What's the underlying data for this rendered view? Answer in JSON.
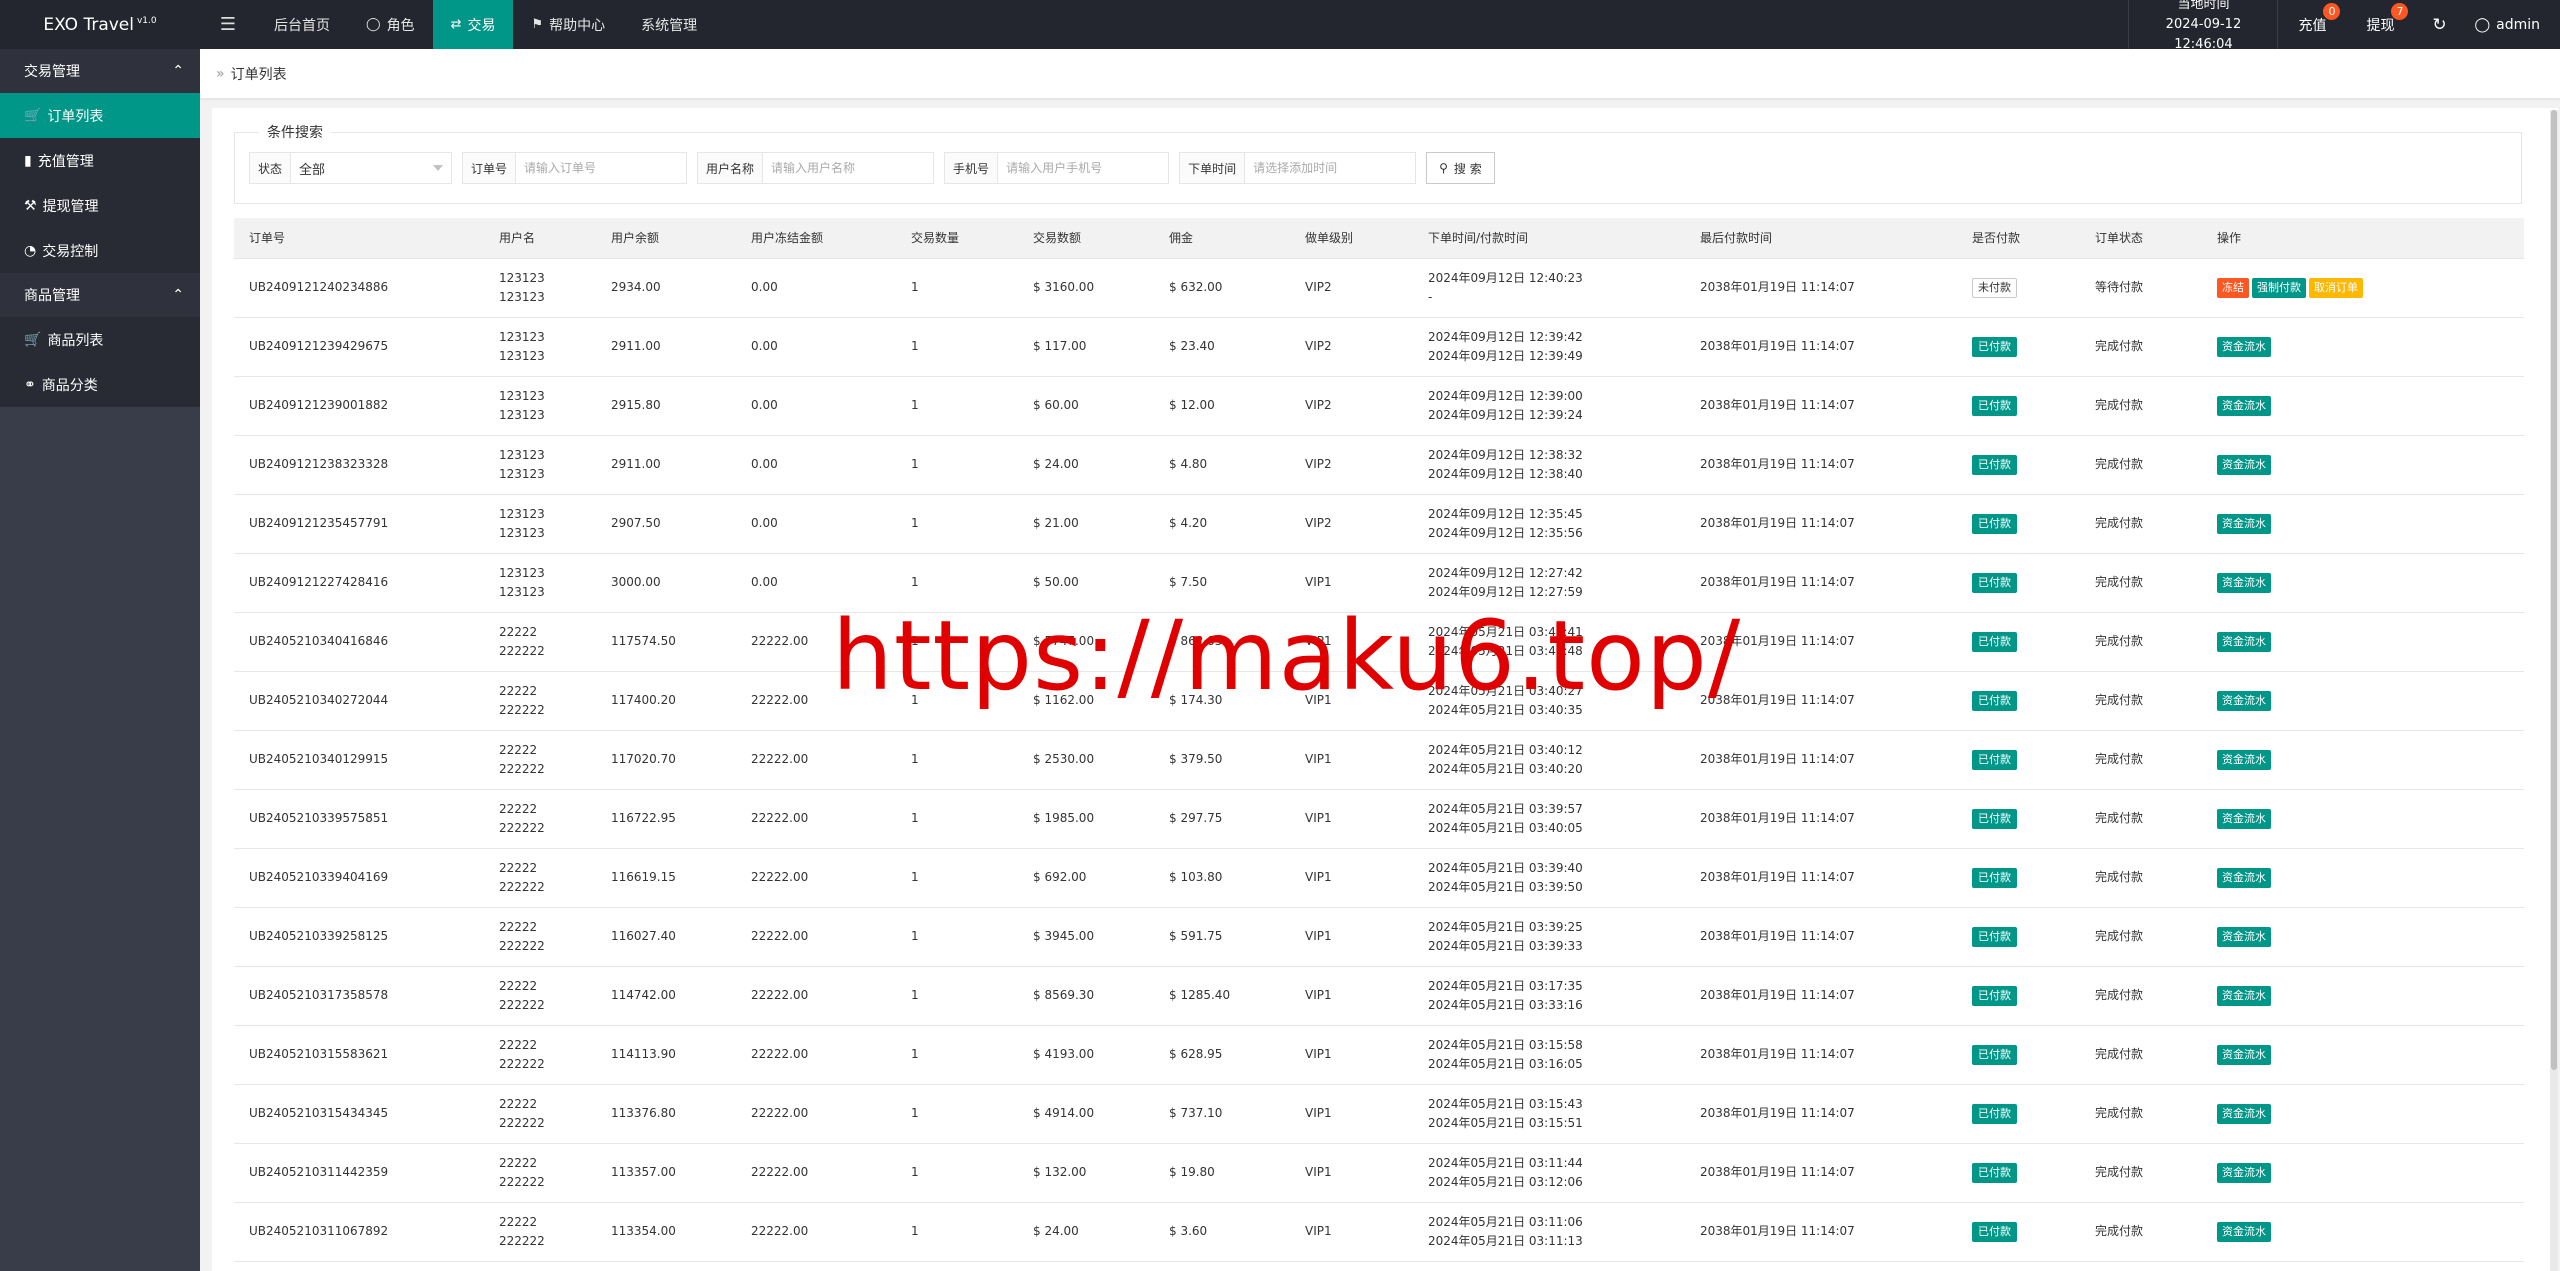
{
  "app": {
    "name": "EXO Travel",
    "version": "v1.0"
  },
  "topnav": [
    {
      "label": "后台首页",
      "icon": "",
      "active": false
    },
    {
      "label": "角色",
      "icon": "user-icon",
      "active": false
    },
    {
      "label": "交易",
      "icon": "exchange-icon",
      "active": true
    },
    {
      "label": "帮助中心",
      "icon": "flag-icon",
      "active": false
    },
    {
      "label": "系统管理",
      "icon": "",
      "active": false
    }
  ],
  "clock": {
    "label": "当地时间",
    "value": "2024-09-12 12:46:04"
  },
  "recharge": {
    "label": "充值",
    "badge": "0"
  },
  "withdraw": {
    "label": "提现",
    "badge": "7"
  },
  "user": {
    "name": "admin"
  },
  "sidebar": {
    "groups": [
      {
        "label": "交易管理",
        "items": [
          {
            "label": "订单列表",
            "icon": "cart-icon",
            "active": true
          },
          {
            "label": "充值管理",
            "icon": "comment-icon",
            "active": false
          },
          {
            "label": "提现管理",
            "icon": "hammer-icon",
            "active": false
          },
          {
            "label": "交易控制",
            "icon": "gauge-icon",
            "active": false
          }
        ]
      },
      {
        "label": "商品管理",
        "items": [
          {
            "label": "商品列表",
            "icon": "cart-icon",
            "active": false
          },
          {
            "label": "商品分类",
            "icon": "link-icon",
            "active": false
          }
        ]
      }
    ]
  },
  "breadcrumb": {
    "label": "订单列表"
  },
  "search": {
    "legend": "条件搜索",
    "status_label": "状态",
    "status_value": "全部",
    "order_label": "订单号",
    "order_placeholder": "请输入订单号",
    "username_label": "用户名称",
    "username_placeholder": "请输入用户名称",
    "phone_label": "手机号",
    "phone_placeholder": "请输入用户手机号",
    "time_label": "下单时间",
    "time_placeholder": "请选择添加时间",
    "button_label": "搜 索"
  },
  "table": {
    "headers": [
      "订单号",
      "用户名",
      "用户余额",
      "用户冻结金额",
      "交易数量",
      "交易数额",
      "佣金",
      "做单级别",
      "下单时间/付款时间",
      "最后付款时间",
      "是否付款",
      "订单状态",
      "操作"
    ],
    "rows": [
      {
        "order": "UB2409121240234886",
        "user1": "123123",
        "user2": "123123",
        "balance": "2934.00",
        "frozen": "0.00",
        "qty": "1",
        "amount": "$ 3160.00",
        "commission": "$ 632.00",
        "level": "VIP2",
        "time1": "2024年09月12日 12:40:23",
        "time2": "-",
        "last": "2038年01月19日 11:14:07",
        "paid": "未付款",
        "paid_state": "unpaid",
        "status": "等待付款",
        "actions": [
          "冻结",
          "强制付款",
          "取消订单"
        ]
      },
      {
        "order": "UB2409121239429675",
        "user1": "123123",
        "user2": "123123",
        "balance": "2911.00",
        "frozen": "0.00",
        "qty": "1",
        "amount": "$ 117.00",
        "commission": "$ 23.40",
        "level": "VIP2",
        "time1": "2024年09月12日 12:39:42",
        "time2": "2024年09月12日 12:39:49",
        "last": "2038年01月19日 11:14:07",
        "paid": "已付款",
        "paid_state": "paid",
        "status": "完成付款",
        "actions": [
          "资金流水"
        ]
      },
      {
        "order": "UB2409121239001882",
        "user1": "123123",
        "user2": "123123",
        "balance": "2915.80",
        "frozen": "0.00",
        "qty": "1",
        "amount": "$ 60.00",
        "commission": "$ 12.00",
        "level": "VIP2",
        "time1": "2024年09月12日 12:39:00",
        "time2": "2024年09月12日 12:39:24",
        "last": "2038年01月19日 11:14:07",
        "paid": "已付款",
        "paid_state": "paid",
        "status": "完成付款",
        "actions": [
          "资金流水"
        ]
      },
      {
        "order": "UB2409121238323328",
        "user1": "123123",
        "user2": "123123",
        "balance": "2911.00",
        "frozen": "0.00",
        "qty": "1",
        "amount": "$ 24.00",
        "commission": "$ 4.80",
        "level": "VIP2",
        "time1": "2024年09月12日 12:38:32",
        "time2": "2024年09月12日 12:38:40",
        "last": "2038年01月19日 11:14:07",
        "paid": "已付款",
        "paid_state": "paid",
        "status": "完成付款",
        "actions": [
          "资金流水"
        ]
      },
      {
        "order": "UB2409121235457791",
        "user1": "123123",
        "user2": "123123",
        "balance": "2907.50",
        "frozen": "0.00",
        "qty": "1",
        "amount": "$ 21.00",
        "commission": "$ 4.20",
        "level": "VIP2",
        "time1": "2024年09月12日 12:35:45",
        "time2": "2024年09月12日 12:35:56",
        "last": "2038年01月19日 11:14:07",
        "paid": "已付款",
        "paid_state": "paid",
        "status": "完成付款",
        "actions": [
          "资金流水"
        ]
      },
      {
        "order": "UB2409121227428416",
        "user1": "123123",
        "user2": "123123",
        "balance": "3000.00",
        "frozen": "0.00",
        "qty": "1",
        "amount": "$ 50.00",
        "commission": "$ 7.50",
        "level": "VIP1",
        "time1": "2024年09月12日 12:27:42",
        "time2": "2024年09月12日 12:27:59",
        "last": "2038年01月19日 11:14:07",
        "paid": "已付款",
        "paid_state": "paid",
        "status": "完成付款",
        "actions": [
          "资金流水"
        ]
      },
      {
        "order": "UB2405210340416846",
        "user1": "22222",
        "user2": "222222",
        "balance": "117574.50",
        "frozen": "22222.00",
        "qty": "1",
        "amount": "$ 5747.00",
        "commission": "$ 862.05",
        "level": "VIP1",
        "time1": "2024年05月21日 03:40:41",
        "time2": "2024年05月21日 03:40:48",
        "last": "2038年01月19日 11:14:07",
        "paid": "已付款",
        "paid_state": "paid",
        "status": "完成付款",
        "actions": [
          "资金流水"
        ]
      },
      {
        "order": "UB2405210340272044",
        "user1": "22222",
        "user2": "222222",
        "balance": "117400.20",
        "frozen": "22222.00",
        "qty": "1",
        "amount": "$ 1162.00",
        "commission": "$ 174.30",
        "level": "VIP1",
        "time1": "2024年05月21日 03:40:27",
        "time2": "2024年05月21日 03:40:35",
        "last": "2038年01月19日 11:14:07",
        "paid": "已付款",
        "paid_state": "paid",
        "status": "完成付款",
        "actions": [
          "资金流水"
        ]
      },
      {
        "order": "UB2405210340129915",
        "user1": "22222",
        "user2": "222222",
        "balance": "117020.70",
        "frozen": "22222.00",
        "qty": "1",
        "amount": "$ 2530.00",
        "commission": "$ 379.50",
        "level": "VIP1",
        "time1": "2024年05月21日 03:40:12",
        "time2": "2024年05月21日 03:40:20",
        "last": "2038年01月19日 11:14:07",
        "paid": "已付款",
        "paid_state": "paid",
        "status": "完成付款",
        "actions": [
          "资金流水"
        ]
      },
      {
        "order": "UB2405210339575851",
        "user1": "22222",
        "user2": "222222",
        "balance": "116722.95",
        "frozen": "22222.00",
        "qty": "1",
        "amount": "$ 1985.00",
        "commission": "$ 297.75",
        "level": "VIP1",
        "time1": "2024年05月21日 03:39:57",
        "time2": "2024年05月21日 03:40:05",
        "last": "2038年01月19日 11:14:07",
        "paid": "已付款",
        "paid_state": "paid",
        "status": "完成付款",
        "actions": [
          "资金流水"
        ]
      },
      {
        "order": "UB2405210339404169",
        "user1": "22222",
        "user2": "222222",
        "balance": "116619.15",
        "frozen": "22222.00",
        "qty": "1",
        "amount": "$ 692.00",
        "commission": "$ 103.80",
        "level": "VIP1",
        "time1": "2024年05月21日 03:39:40",
        "time2": "2024年05月21日 03:39:50",
        "last": "2038年01月19日 11:14:07",
        "paid": "已付款",
        "paid_state": "paid",
        "status": "完成付款",
        "actions": [
          "资金流水"
        ]
      },
      {
        "order": "UB2405210339258125",
        "user1": "22222",
        "user2": "222222",
        "balance": "116027.40",
        "frozen": "22222.00",
        "qty": "1",
        "amount": "$ 3945.00",
        "commission": "$ 591.75",
        "level": "VIP1",
        "time1": "2024年05月21日 03:39:25",
        "time2": "2024年05月21日 03:39:33",
        "last": "2038年01月19日 11:14:07",
        "paid": "已付款",
        "paid_state": "paid",
        "status": "完成付款",
        "actions": [
          "资金流水"
        ]
      },
      {
        "order": "UB2405210317358578",
        "user1": "22222",
        "user2": "222222",
        "balance": "114742.00",
        "frozen": "22222.00",
        "qty": "1",
        "amount": "$ 8569.30",
        "commission": "$ 1285.40",
        "level": "VIP1",
        "time1": "2024年05月21日 03:17:35",
        "time2": "2024年05月21日 03:33:16",
        "last": "2038年01月19日 11:14:07",
        "paid": "已付款",
        "paid_state": "paid",
        "status": "完成付款",
        "actions": [
          "资金流水"
        ]
      },
      {
        "order": "UB2405210315583621",
        "user1": "22222",
        "user2": "222222",
        "balance": "114113.90",
        "frozen": "22222.00",
        "qty": "1",
        "amount": "$ 4193.00",
        "commission": "$ 628.95",
        "level": "VIP1",
        "time1": "2024年05月21日 03:15:58",
        "time2": "2024年05月21日 03:16:05",
        "last": "2038年01月19日 11:14:07",
        "paid": "已付款",
        "paid_state": "paid",
        "status": "完成付款",
        "actions": [
          "资金流水"
        ]
      },
      {
        "order": "UB2405210315434345",
        "user1": "22222",
        "user2": "222222",
        "balance": "113376.80",
        "frozen": "22222.00",
        "qty": "1",
        "amount": "$ 4914.00",
        "commission": "$ 737.10",
        "level": "VIP1",
        "time1": "2024年05月21日 03:15:43",
        "time2": "2024年05月21日 03:15:51",
        "last": "2038年01月19日 11:14:07",
        "paid": "已付款",
        "paid_state": "paid",
        "status": "完成付款",
        "actions": [
          "资金流水"
        ]
      },
      {
        "order": "UB2405210311442359",
        "user1": "22222",
        "user2": "222222",
        "balance": "113357.00",
        "frozen": "22222.00",
        "qty": "1",
        "amount": "$ 132.00",
        "commission": "$ 19.80",
        "level": "VIP1",
        "time1": "2024年05月21日 03:11:44",
        "time2": "2024年05月21日 03:12:06",
        "last": "2038年01月19日 11:14:07",
        "paid": "已付款",
        "paid_state": "paid",
        "status": "完成付款",
        "actions": [
          "资金流水"
        ]
      },
      {
        "order": "UB2405210311067892",
        "user1": "22222",
        "user2": "222222",
        "balance": "113354.00",
        "frozen": "22222.00",
        "qty": "1",
        "amount": "$ 24.00",
        "commission": "$ 3.60",
        "level": "VIP1",
        "time1": "2024年05月21日 03:11:06",
        "time2": "2024年05月21日 03:11:13",
        "last": "2038年01月19日 11:14:07",
        "paid": "已付款",
        "paid_state": "paid",
        "status": "完成付款",
        "actions": [
          "资金流水"
        ]
      }
    ]
  },
  "watermark": "https://maku6.top/",
  "colors": {
    "accent": "#009688",
    "danger": "#ff5722",
    "warn": "#ffb800",
    "topbar": "#23262e",
    "sidebar": "#393d49"
  }
}
